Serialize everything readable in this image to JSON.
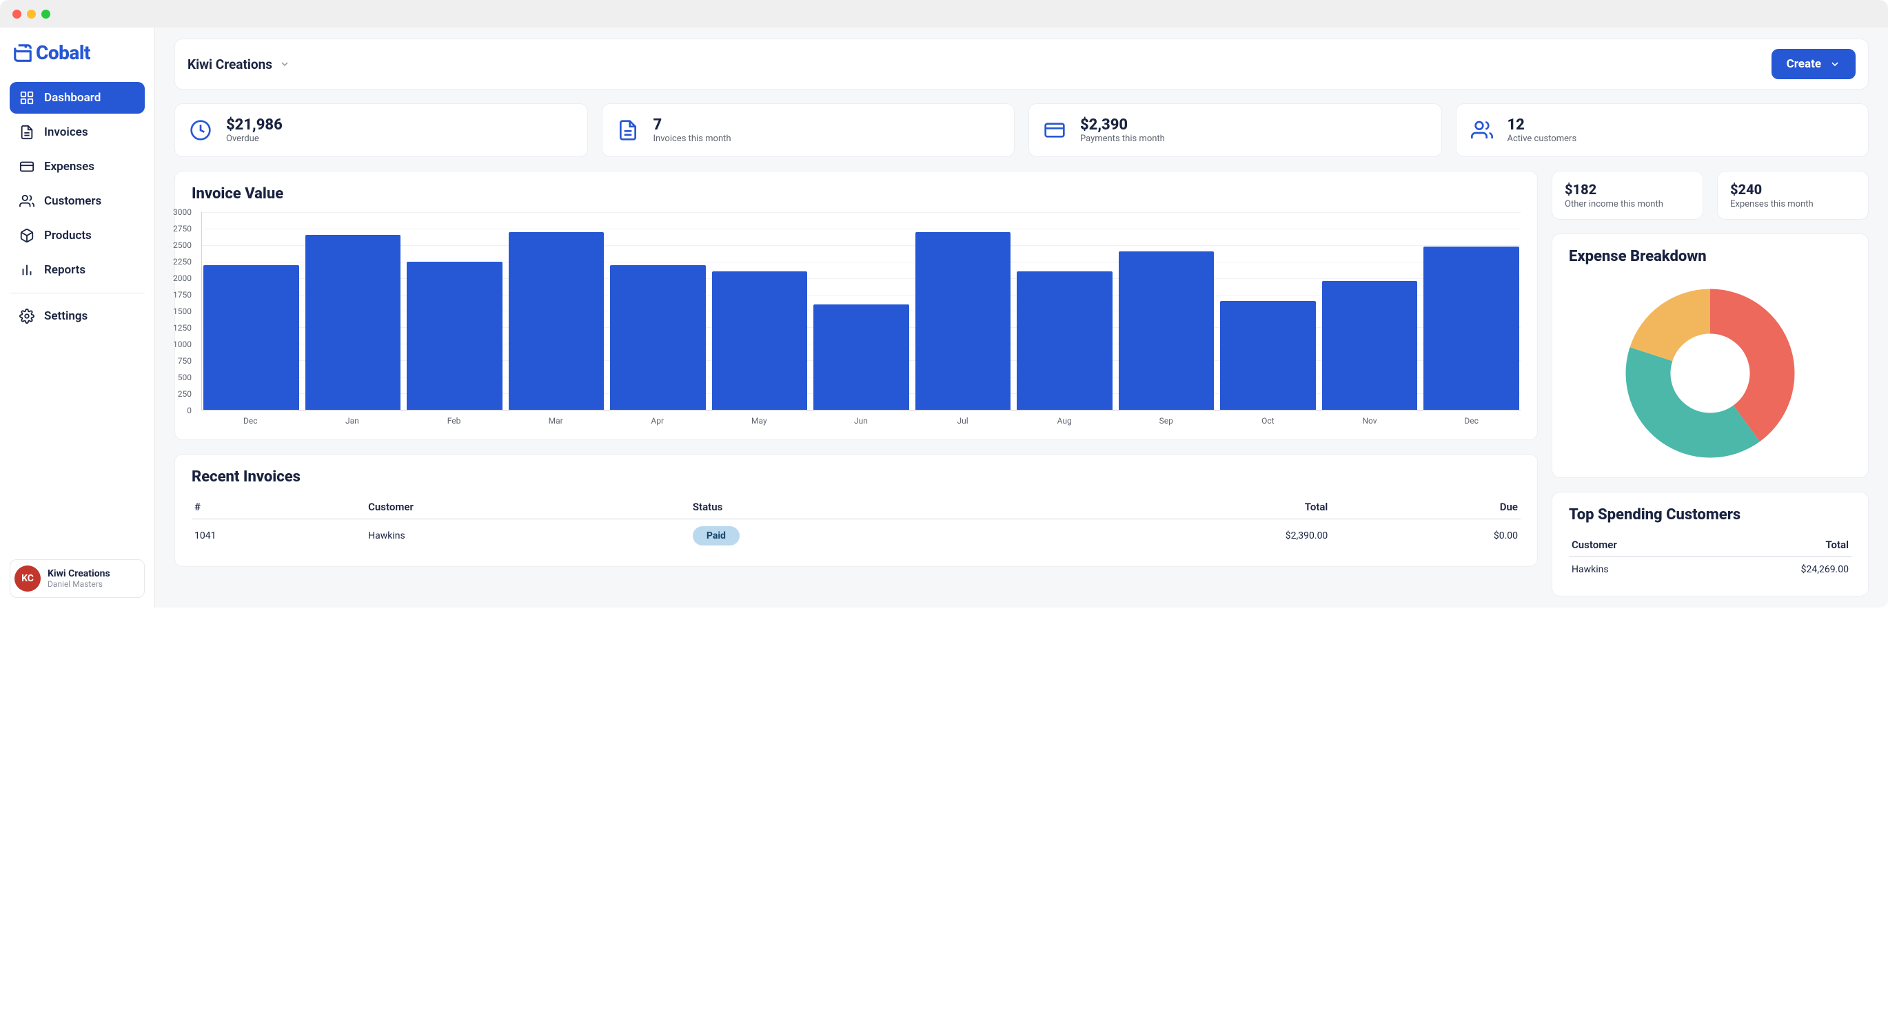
{
  "brand": {
    "name": "Cobalt"
  },
  "sidebar": {
    "items": [
      {
        "label": "Dashboard",
        "active": true
      },
      {
        "label": "Invoices"
      },
      {
        "label": "Expenses"
      },
      {
        "label": "Customers"
      },
      {
        "label": "Products"
      },
      {
        "label": "Reports"
      }
    ],
    "settings_label": "Settings"
  },
  "account": {
    "initials": "KC",
    "company": "Kiwi Creations",
    "user": "Daniel Masters"
  },
  "topbar": {
    "company": "Kiwi Creations",
    "create_label": "Create"
  },
  "kpis": [
    {
      "value": "$21,986",
      "label": "Overdue",
      "icon": "clock"
    },
    {
      "value": "7",
      "label": "Invoices this month",
      "icon": "file"
    },
    {
      "value": "$2,390",
      "label": "Payments this month",
      "icon": "card"
    },
    {
      "value": "12",
      "label": "Active customers",
      "icon": "users"
    }
  ],
  "minis": [
    {
      "value": "$182",
      "label": "Other income this month"
    },
    {
      "value": "$240",
      "label": "Expenses this month"
    }
  ],
  "chart_data": {
    "type": "bar",
    "title": "Invoice Value",
    "categories": [
      "Dec",
      "Jan",
      "Feb",
      "Mar",
      "Apr",
      "May",
      "Jun",
      "Jul",
      "Aug",
      "Sep",
      "Oct",
      "Nov",
      "Dec"
    ],
    "values": [
      2200,
      2650,
      2250,
      2700,
      2200,
      2100,
      1600,
      2700,
      2100,
      2400,
      1650,
      1950,
      2480
    ],
    "xlabel": "",
    "ylabel": "",
    "ylim": [
      0,
      3000
    ],
    "ytick": 250
  },
  "expense_chart": {
    "title": "Expense Breakdown",
    "type": "donut",
    "slices": [
      {
        "color": "#ec695b",
        "value": 40
      },
      {
        "color": "#4bb8a9",
        "value": 40
      },
      {
        "color": "#f2b75c",
        "value": 20
      }
    ]
  },
  "recent_invoices": {
    "title": "Recent Invoices",
    "columns": [
      "#",
      "Customer",
      "Status",
      "Total",
      "Due"
    ],
    "rows": [
      {
        "no": "1041",
        "customer": "Hawkins",
        "status": "Paid",
        "total": "$2,390.00",
        "due": "$0.00"
      }
    ]
  },
  "top_customers": {
    "title": "Top Spending Customers",
    "columns": [
      "Customer",
      "Total"
    ],
    "rows": [
      {
        "customer": "Hawkins",
        "total": "$24,269.00"
      }
    ]
  }
}
